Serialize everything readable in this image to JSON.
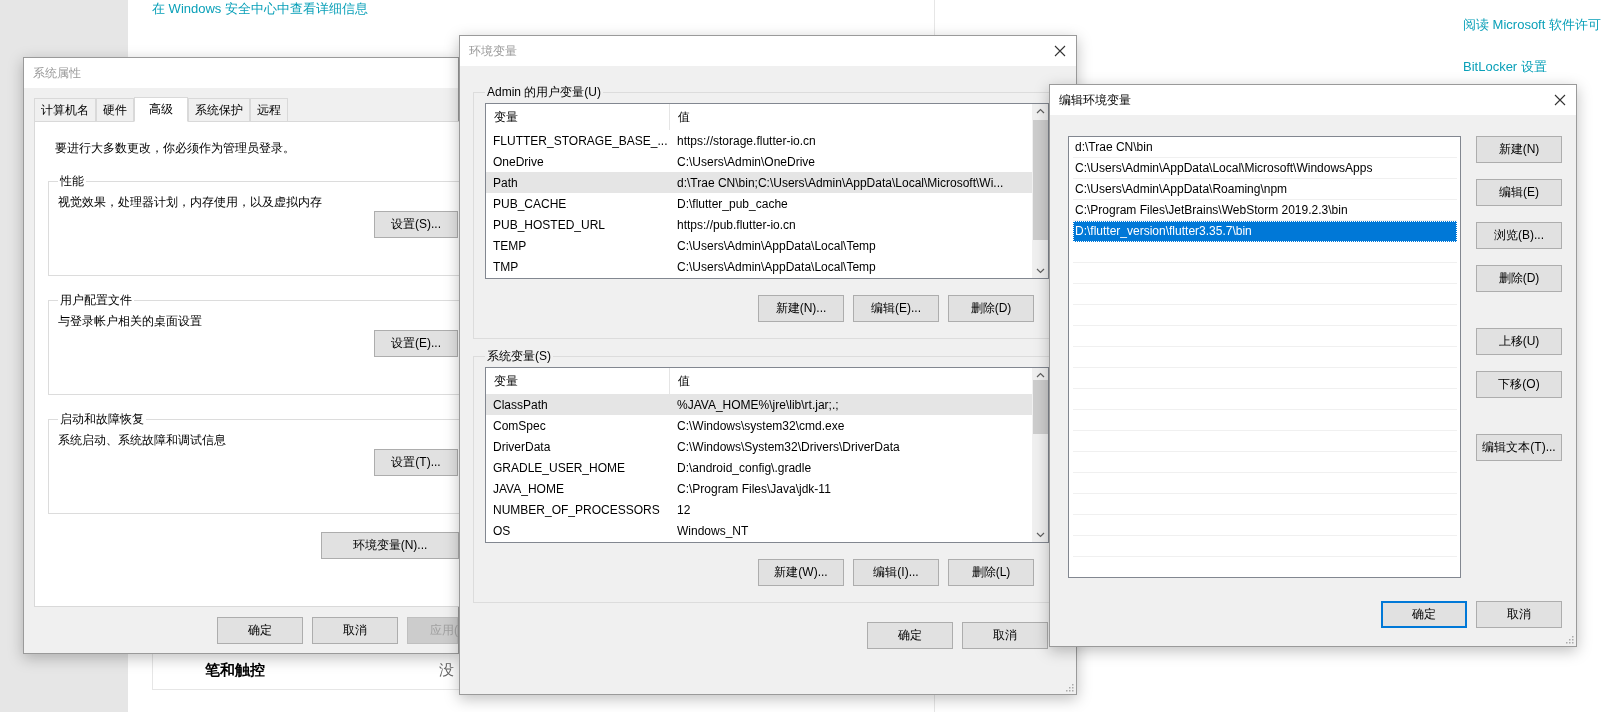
{
  "background": {
    "security_link": "在 Windows 安全中心中查看详细信息",
    "license_link": "阅读 Microsoft 软件许可",
    "bitlocker_link": "BitLocker 设置",
    "setting_row": {
      "label": "笔和触控",
      "value": "没"
    }
  },
  "system_properties": {
    "title": "系统属性",
    "tabs": [
      {
        "label": "计算机名",
        "selected": false
      },
      {
        "label": "硬件",
        "selected": false
      },
      {
        "label": "高级",
        "selected": true
      },
      {
        "label": "系统保护",
        "selected": false
      },
      {
        "label": "远程",
        "selected": false
      }
    ],
    "notice": "要进行大多数更改，你必须作为管理员登录。",
    "groups": [
      {
        "title": "性能",
        "description": "视觉效果，处理器计划，内存使用，以及虚拟内存",
        "button": "设置(S)..."
      },
      {
        "title": "用户配置文件",
        "description": "与登录帐户相关的桌面设置",
        "button": "设置(E)..."
      },
      {
        "title": "启动和故障恢复",
        "description": "系统启动、系统故障和调试信息",
        "button": "设置(T)..."
      }
    ],
    "env_button": "环境变量(N)...",
    "buttons": [
      {
        "label": "确定",
        "disabled": false
      },
      {
        "label": "取消",
        "disabled": false
      },
      {
        "label": "应用(",
        "disabled": true
      }
    ]
  },
  "env_vars": {
    "title": "环境变量",
    "user_group": {
      "title": "Admin 的用户变量(U)",
      "columns": [
        "变量",
        "值"
      ],
      "rows": [
        {
          "name": "FLUTTER_STORAGE_BASE_...",
          "value": "https://storage.flutter-io.cn",
          "selected": false
        },
        {
          "name": "OneDrive",
          "value": "C:\\Users\\Admin\\OneDrive",
          "selected": false
        },
        {
          "name": "Path",
          "value": "d:\\Trae CN\\bin;C:\\Users\\Admin\\AppData\\Local\\Microsoft\\Wi...",
          "selected": true
        },
        {
          "name": "PUB_CACHE",
          "value": "D:\\flutter_pub_cache",
          "selected": false
        },
        {
          "name": "PUB_HOSTED_URL",
          "value": "https://pub.flutter-io.cn",
          "selected": false
        },
        {
          "name": "TEMP",
          "value": "C:\\Users\\Admin\\AppData\\Local\\Temp",
          "selected": false
        },
        {
          "name": "TMP",
          "value": "C:\\Users\\Admin\\AppData\\Local\\Temp",
          "selected": false
        }
      ],
      "buttons": [
        "新建(N)...",
        "编辑(E)...",
        "删除(D)"
      ]
    },
    "system_group": {
      "title": "系统变量(S)",
      "columns": [
        "变量",
        "值"
      ],
      "rows": [
        {
          "name": "ClassPath",
          "value": "%JAVA_HOME%\\jre\\lib\\rt.jar;.;",
          "selected": true
        },
        {
          "name": "ComSpec",
          "value": "C:\\Windows\\system32\\cmd.exe",
          "selected": false
        },
        {
          "name": "DriverData",
          "value": "C:\\Windows\\System32\\Drivers\\DriverData",
          "selected": false
        },
        {
          "name": "GRADLE_USER_HOME",
          "value": "D:\\android_config\\.gradle",
          "selected": false
        },
        {
          "name": "JAVA_HOME",
          "value": "C:\\Program Files\\Java\\jdk-11",
          "selected": false
        },
        {
          "name": "NUMBER_OF_PROCESSORS",
          "value": "12",
          "selected": false
        },
        {
          "name": "OS",
          "value": "Windows_NT",
          "selected": false
        }
      ],
      "buttons": [
        "新建(W)...",
        "编辑(I)...",
        "删除(L)"
      ]
    },
    "buttons": [
      "确定",
      "取消"
    ]
  },
  "edit_env": {
    "title": "编辑环境变量",
    "items": [
      {
        "text": "d:\\Trae CN\\bin",
        "selected": false
      },
      {
        "text": "C:\\Users\\Admin\\AppData\\Local\\Microsoft\\WindowsApps",
        "selected": false
      },
      {
        "text": "C:\\Users\\Admin\\AppData\\Roaming\\npm",
        "selected": false
      },
      {
        "text": "C:\\Program Files\\JetBrains\\WebStorm 2019.2.3\\bin",
        "selected": false
      },
      {
        "text": "D:\\flutter_version\\flutter3.35.7\\bin",
        "selected": true
      }
    ],
    "side_button_groups": [
      [
        "新建(N)",
        "编辑(E)",
        "浏览(B)...",
        "删除(D)"
      ],
      [
        "上移(U)",
        "下移(O)"
      ],
      [
        "编辑文本(T)..."
      ]
    ],
    "buttons": [
      {
        "label": "确定",
        "focused": true
      },
      {
        "label": "取消",
        "focused": false
      }
    ]
  }
}
